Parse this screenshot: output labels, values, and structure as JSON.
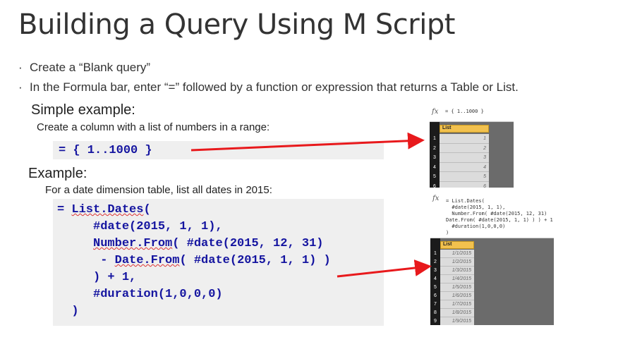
{
  "slide": {
    "title": "Building a Query Using M Script",
    "bullets": [
      "Create a “Blank query”",
      "In the Formula bar, enter “=” followed by a function or expression that returns a Table or List."
    ],
    "simple": {
      "heading": "Simple example:",
      "description": "Create a column with a list of numbers in a range:",
      "code": "= { 1..1000 }"
    },
    "example": {
      "heading": "Example:",
      "description": "For a date dimension table, list all dates in 2015:",
      "code_lines": [
        "= List.Dates(",
        "     #date(2015, 1, 1),",
        "     Number.From( #date(2015, 12, 31)",
        "      - Date.From( #date(2015, 1, 1) )",
        "     ) + 1,",
        "     #duration(1,0,0,0)",
        "  )"
      ]
    }
  },
  "preview1": {
    "fx": "fx",
    "formula": "= { 1..1000 }",
    "column_header": "List",
    "row_numbers": [
      "1",
      "2",
      "3",
      "4",
      "5",
      "6"
    ],
    "values": [
      "1",
      "2",
      "3",
      "4",
      "5",
      "6"
    ]
  },
  "preview2": {
    "fx": "fx",
    "formula_lines": [
      "= List.Dates(",
      "  #date(2015, 1, 1),",
      "  Number.From( #date(2015, 12, 31)   -",
      "Date.From( #date(2015, 1, 1) ) ) + 1,",
      "  #duration(1,0,0,0)",
      ")"
    ],
    "column_header": "List",
    "row_numbers": [
      "1",
      "2",
      "3",
      "4",
      "5",
      "6",
      "7",
      "8",
      "9"
    ],
    "values": [
      "1/1/2015",
      "1/2/2015",
      "1/3/2015",
      "1/4/2015",
      "1/5/2015",
      "1/6/2015",
      "1/7/2015",
      "1/8/2015",
      "1/9/2015"
    ]
  },
  "colors": {
    "arrow": "#e8191c",
    "code": "#1515a0",
    "header": "#f2c14e"
  }
}
